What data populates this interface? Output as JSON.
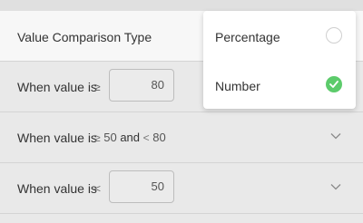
{
  "header": {
    "title": "Value Comparison Type"
  },
  "rows": [
    {
      "label": "When value is",
      "operator": "≥",
      "value": "80"
    },
    {
      "label": "When value is",
      "operator_low": "≥",
      "low": "50",
      "joiner": "and",
      "operator_high": "<",
      "high": "80"
    },
    {
      "label": "When value is",
      "operator": "<",
      "value": "50"
    }
  ],
  "popover": {
    "options": [
      {
        "label": "Percentage",
        "selected": false
      },
      {
        "label": "Number",
        "selected": true
      }
    ]
  },
  "colors": {
    "accent_green": "#5ccb6b"
  },
  "icons": {
    "row_expand": "chevron-down-icon",
    "selected_mark": "checkmark-icon"
  }
}
